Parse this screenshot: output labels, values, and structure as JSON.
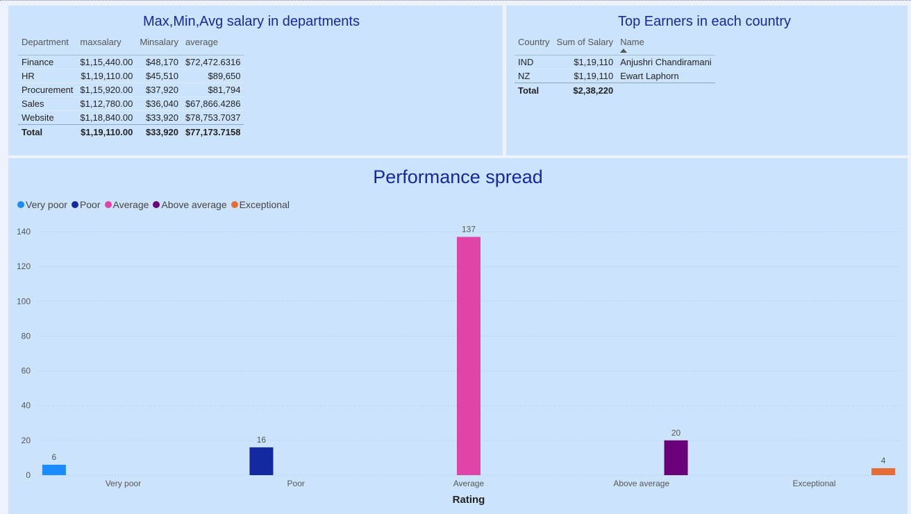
{
  "salary_table": {
    "title": "Max,Min,Avg salary in departments",
    "columns": [
      "Department",
      "maxsalary",
      "Minsalary",
      "average"
    ],
    "rows": [
      [
        "Finance",
        "$1,15,440.00",
        "$48,170",
        "$72,472.6316"
      ],
      [
        "HR",
        "$1,19,110.00",
        "$45,510",
        "$89,650"
      ],
      [
        "Procurement",
        "$1,15,920.00",
        "$37,920",
        "$81,794"
      ],
      [
        "Sales",
        "$1,12,780.00",
        "$36,040",
        "$67,866.4286"
      ],
      [
        "Website",
        "$1,18,840.00",
        "$33,920",
        "$78,753.7037"
      ]
    ],
    "total": [
      "Total",
      "$1,19,110.00",
      "$33,920",
      "$77,173.7158"
    ]
  },
  "earners_table": {
    "title": "Top Earners in each country",
    "columns": [
      "Country",
      "Sum of Salary",
      "Name"
    ],
    "rows": [
      [
        "IND",
        "$1,19,110",
        "Anjushri Chandiramani"
      ],
      [
        "NZ",
        "$1,19,110",
        "Ewart Laphorn"
      ]
    ],
    "total": [
      "Total",
      "$2,38,220",
      ""
    ]
  },
  "chart_data": {
    "type": "bar",
    "title": "Performance spread",
    "xlabel": "Rating",
    "ylabel": "",
    "categories": [
      "Very poor",
      "Poor",
      "Average",
      "Above average",
      "Exceptional"
    ],
    "series": [
      {
        "name": "Very poor",
        "color": "#1a8cff",
        "values": [
          6,
          null,
          null,
          null,
          null
        ]
      },
      {
        "name": "Poor",
        "color": "#1428a0",
        "values": [
          null,
          16,
          null,
          null,
          null
        ]
      },
      {
        "name": "Average",
        "color": "#e044a7",
        "values": [
          null,
          null,
          137,
          null,
          null
        ]
      },
      {
        "name": "Above average",
        "color": "#6b007b",
        "values": [
          null,
          null,
          null,
          20,
          null
        ]
      },
      {
        "name": "Exceptional",
        "color": "#e66c37",
        "values": [
          null,
          null,
          null,
          null,
          4
        ]
      }
    ],
    "ylim": [
      0,
      140
    ],
    "yticks": [
      0,
      20,
      40,
      60,
      80,
      100,
      120,
      140
    ],
    "grid": true,
    "legend": "top-left",
    "data_labels": true
  }
}
